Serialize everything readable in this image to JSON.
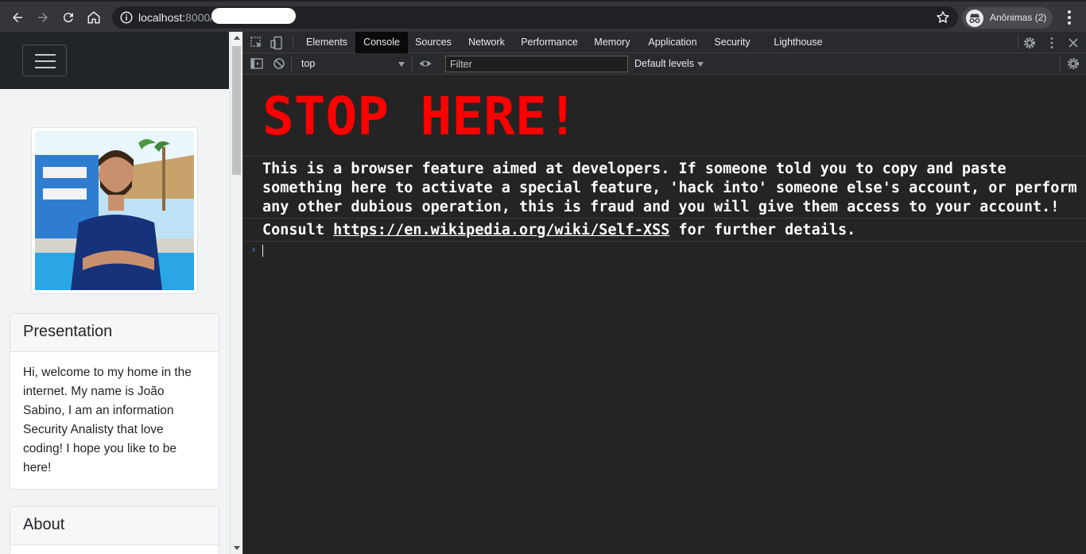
{
  "browser": {
    "url_host": "localhost:",
    "url_port": "8000/",
    "profile_label": "Anônimas (2)"
  },
  "page": {
    "presentation": {
      "title": "Presentation",
      "body": "Hi, welcome to my home in the internet. My name is João Sabino, I am an information Security Analisty that love coding! I hope you like to be here!"
    },
    "about": {
      "title": "About"
    }
  },
  "devtools": {
    "tabs": [
      {
        "label": "Elements"
      },
      {
        "label": "Console"
      },
      {
        "label": "Sources"
      },
      {
        "label": "Network"
      },
      {
        "label": "Performance"
      },
      {
        "label": "Memory"
      },
      {
        "label": "Application"
      },
      {
        "label": "Security"
      },
      {
        "label": "Lighthouse"
      }
    ],
    "active_tab": "Console",
    "context": "top",
    "filter_placeholder": "Filter",
    "levels": "Default levels"
  },
  "console": {
    "stop": "STOP HERE!",
    "warning": "This is a browser feature aimed at developers. If someone told you to copy and paste something here to activate a special feature, 'hack into' someone else's account, or perform any other dubious operation, this is fraud and you will give them access to your account.!",
    "consult_prefix": "Consult ",
    "consult_link": "https://en.wikipedia.org/wiki/Self-XSS",
    "consult_suffix": " for further details."
  },
  "colors": {
    "stop_red": "#ff0000",
    "prompt_blue": "#4d90fe"
  }
}
